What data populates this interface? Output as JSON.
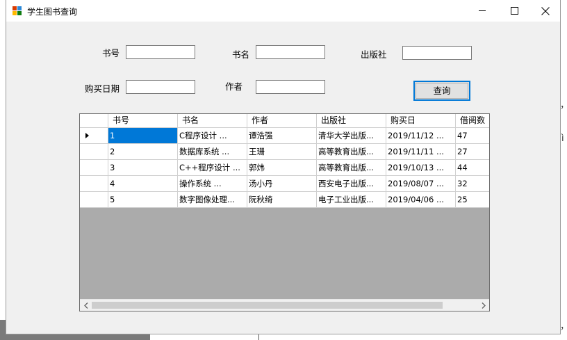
{
  "window": {
    "title": "学生图书查询",
    "controls": {
      "minimize": "minimize-icon",
      "maximize": "maximize-icon",
      "close": "close-icon"
    }
  },
  "form": {
    "book_no_label": "书号",
    "book_name_label": "书名",
    "publisher_label": "出版社",
    "purchase_date_label": "购买日期",
    "author_label": "作者",
    "book_no_value": "",
    "book_name_value": "",
    "publisher_value": "",
    "purchase_date_value": "",
    "author_value": "",
    "query_button": "查询"
  },
  "grid": {
    "columns": [
      "书号",
      "书名",
      "作者",
      "出版社",
      "购买日",
      "借阅数"
    ],
    "rows": [
      [
        "1",
        "C程序设计    ...",
        "谭浩强",
        "清华大学出版...",
        "2019/11/12   ...",
        "47"
      ],
      [
        "2",
        "数据库系统   ...",
        "王珊",
        "高等教育出版...",
        "2019/11/11   ...",
        "27"
      ],
      [
        "3",
        "C++程序设计 ...",
        "郭炜",
        "高等教育出版...",
        "2019/10/13   ...",
        "44"
      ],
      [
        "4",
        "操作系统     ...",
        "汤小丹",
        "西安电子出版...",
        "2019/08/07   ...",
        "32"
      ],
      [
        "5",
        "数字图像处理...",
        "阮秋绮",
        "电子工业出版...",
        "2019/04/06   ...",
        "25"
      ]
    ],
    "selected_row": 0
  },
  "background": {
    "glyph_1": "，",
    "glyph_2": "ì",
    "glyph_3": "，"
  }
}
